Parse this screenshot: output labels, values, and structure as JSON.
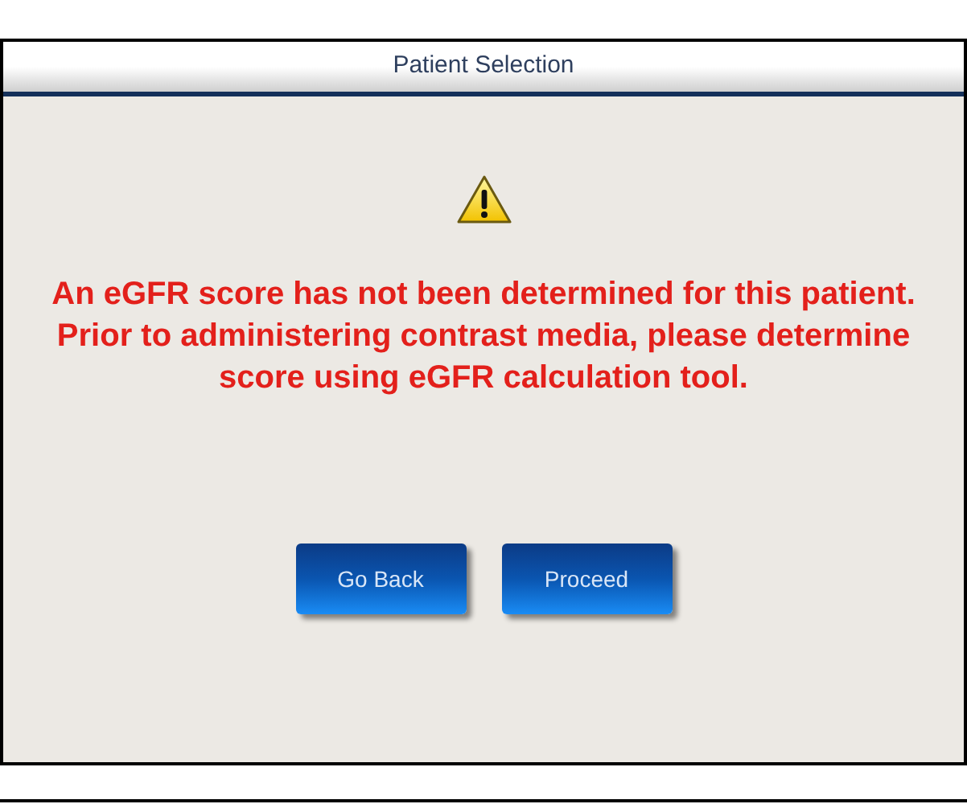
{
  "window": {
    "title": "Patient Selection"
  },
  "alert": {
    "kind": "warning",
    "message": "An eGFR score has not been determined for this patient. Prior to administering contrast media, please determine score using eGFR calculation tool."
  },
  "buttons": [
    {
      "label": "Go Back"
    },
    {
      "label": "Proceed"
    }
  ]
}
